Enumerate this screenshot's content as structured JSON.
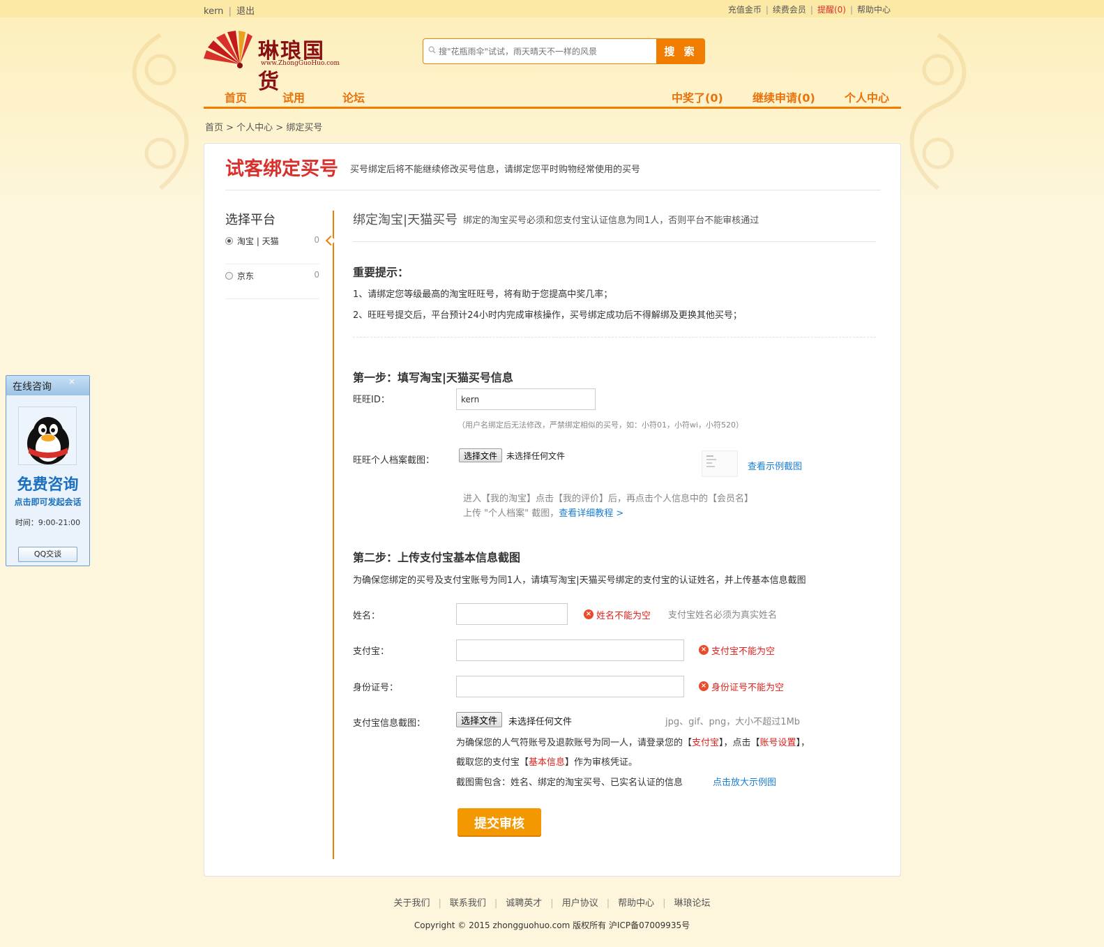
{
  "topbar": {
    "user": "kern",
    "logout": "退出",
    "links": [
      "充值金币",
      "续费会员",
      "提醒(0)",
      "帮助中心"
    ]
  },
  "logo": {
    "name": "琳琅国货",
    "url": "www.ZhongGuoHuo.com"
  },
  "search": {
    "placeholder": "搜\"花瓶雨伞\"试试，雨天晴天不一样的风景",
    "button": "搜 索"
  },
  "nav": {
    "left": [
      "首页",
      "试用",
      "论坛"
    ],
    "right": [
      "中奖了(0)",
      "继续申请(0)",
      "个人中心"
    ]
  },
  "breadcrumb": "首页 > 个人中心 > 绑定买号",
  "panel": {
    "title": "试客绑定买号",
    "subtitle": "买号绑定后将不能继续修改买号信息，请绑定您平时购物经常使用的买号"
  },
  "sidebar": {
    "title": "选择平台",
    "options": [
      {
        "label": "淘宝 | 天猫",
        "count": "0",
        "selected": true
      },
      {
        "label": "京东",
        "count": "0",
        "selected": false
      }
    ]
  },
  "main": {
    "heading": "绑定淘宝|天猫买号",
    "heading_note": "绑定的淘宝买号必须和您支付宝认证信息为同1人，否则平台不能审核通过",
    "tips_title": "重要提示：",
    "tips": [
      "1、请绑定您等级最高的淘宝旺旺号，将有助于您提高中奖几率；",
      "2、旺旺号提交后，平台预计24小时内完成审核操作，买号绑定成功后不得解绑及更换其他买号；"
    ],
    "step1": {
      "title": "第一步：填写淘宝|天猫买号信息",
      "wangwang_label": "旺旺ID：",
      "wangwang_value": "kern",
      "wangwang_hint": "（用户名绑定后无法修改，严禁绑定相似的买号，如：小符01，小符wi，小符520）",
      "screenshot_label": "旺旺个人档案截图：",
      "file_button": "选择文件",
      "file_status": "未选择任何文件",
      "example_link": "查看示例截图",
      "guide_line1": "进入【我的淘宝】点击【我的评价】后，再点击个人信息中的【会员名】",
      "guide_line2_prefix": "上传 \"个人档案\" 截图，",
      "guide_link": "查看详细教程 >"
    },
    "step2": {
      "title": "第二步：上传支付宝基本信息截图",
      "desc": "为确保您绑定的买号及支付宝账号为同1人，请填写淘宝|天猫买号绑定的支付宝的认证姓名，并上传基本信息截图",
      "name_label": "姓名：",
      "name_error": "姓名不能为空",
      "name_hint": "支付宝姓名必须为真实姓名",
      "alipay_label": "支付宝：",
      "alipay_error": "支付宝不能为空",
      "idcard_label": "身份证号：",
      "idcard_error": "身份证号不能为空",
      "screenshot_label": "支付宝信息截图：",
      "file_button": "选择文件",
      "file_status": "未选择任何文件",
      "file_hint": "jpg、gif、png，大小不超过1Mb",
      "line1_a": "为确保您的人气符账号及退款账号为同一人，请登录您的【",
      "line1_b": "支付宝",
      "line1_c": "】，点击【",
      "line1_d": "账号设置",
      "line1_e": "】，",
      "line2_a": "截取您的支付宝【",
      "line2_b": "基本信息",
      "line2_c": "】作为审核凭证。",
      "line3": "截图需包含：姓名、绑定的淘宝买号、已实名认证的信息",
      "line3_link": "点击放大示例图",
      "submit": "提交审核"
    }
  },
  "footer": {
    "links": [
      "关于我们",
      "联系我们",
      "诚聘英才",
      "用户协议",
      "帮助中心",
      "琳琅论坛"
    ],
    "copyright": "Copyright © 2015 zhongguohuo.com 版权所有 沪ICP备07009935号"
  },
  "qq_widget": {
    "title": "在线咨询",
    "close": "×",
    "free": "免费咨询",
    "click": "点击即可发起会话",
    "time": "时间：9:00-21:00",
    "button": "QQ交谈"
  },
  "colors": {
    "accent": "#f07d00",
    "title_red": "#d9302c",
    "link_blue": "#1a7ed4"
  }
}
